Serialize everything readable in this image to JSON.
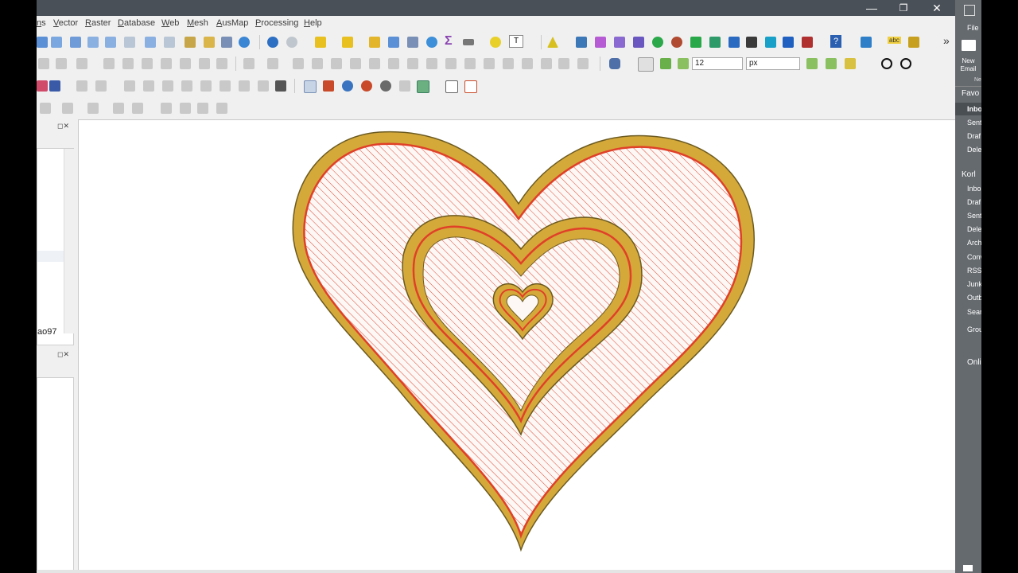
{
  "window": {
    "minimize_glyph": "—",
    "restore_glyph": "❐",
    "close_glyph": "✕"
  },
  "menu": {
    "items": [
      "ns",
      "Vector",
      "Raster",
      "Database",
      "Web",
      "Mesh",
      "AusMap",
      "Processing",
      "Help"
    ]
  },
  "snapping": {
    "tolerance_value": "12",
    "units_value": "px"
  },
  "left_panel": {
    "layer_label": "ao97",
    "panel_controls": "◻✕"
  },
  "toolbar": {
    "overflow_glyph": "»",
    "text_tool_glyph": "T",
    "label_tool_text": "abc",
    "sum_glyph": "Σ",
    "help_glyph": "?"
  },
  "mail": {
    "file_label": "File",
    "new_email_label": "New Email",
    "new_suffix": "Ne",
    "favorites_header": "Favo",
    "favorites": [
      "Inbo",
      "Sent",
      "Draf",
      "Dele"
    ],
    "account_header": "Korl",
    "account_folders": [
      "Inbo",
      "Draf",
      "Sent",
      "Dele",
      "Arch"
    ],
    "expandable": [
      "Conv",
      "Sear",
      "Grou"
    ],
    "plain_items": [
      "RSS I",
      "Junk",
      "Outb"
    ],
    "online_item": "Onli"
  },
  "colors": {
    "titlebar": "#495057",
    "heart_fill": "#d4a93a",
    "heart_outline": "#e04028",
    "hatch": "#e0462e",
    "mail_sidebar": "#656a6f"
  }
}
